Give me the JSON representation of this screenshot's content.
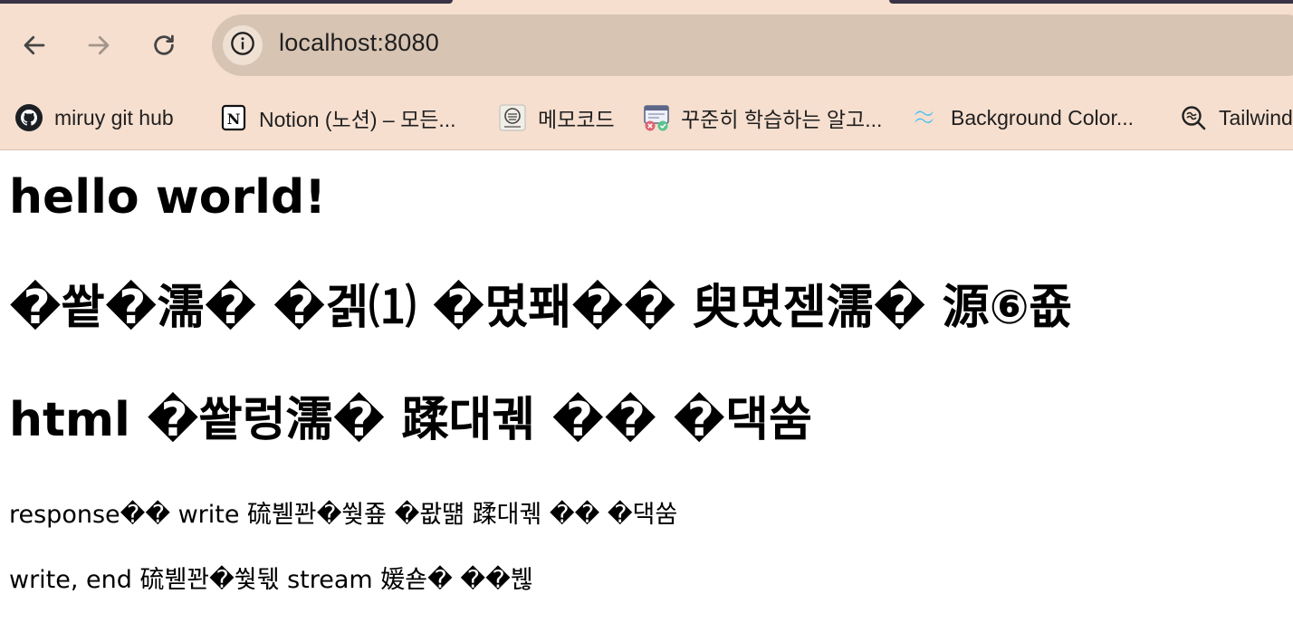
{
  "browser": {
    "url": "localhost:8080",
    "nav": {
      "back_icon": "arrow-left-icon",
      "forward_icon": "arrow-right-icon",
      "reload_icon": "reload-icon",
      "site_info_icon": "info-icon"
    },
    "bookmarks": [
      {
        "label": "miruy git hub",
        "icon": "github-icon"
      },
      {
        "label": "Notion (노션) – 모든...",
        "icon": "notion-icon"
      },
      {
        "label": "메모코드",
        "icon": "memocode-icon"
      },
      {
        "label": "꾸준히 학습하는 알고...",
        "icon": "algorithm-icon"
      },
      {
        "label": "Background Color...",
        "icon": "tailwind-icon"
      },
      {
        "label": "Tailwind",
        "icon": "search-magnifier-icon"
      }
    ],
    "colors": {
      "chrome_bg": "#f6dfcf",
      "address_bg": "#d8c4b3",
      "tab_edge": "#3a3346"
    }
  },
  "page": {
    "heading_1": "hello world!",
    "heading_2": "�쐍�濡� �겕⑴ �몄퐤�� 臾몄젣濡� 源⑥죲",
    "heading_3": "html �쐍렁濡� 蹂대궦 �� �댁쑴",
    "paragraph_1": "response�� write 硫붿꽌�쒖죺 �뫖떎 蹂대궦 �� �댁쑴",
    "paragraph_2": "write, end 硫붿꽌�쒗뒋 stream 媛숃� ��붾"
  }
}
